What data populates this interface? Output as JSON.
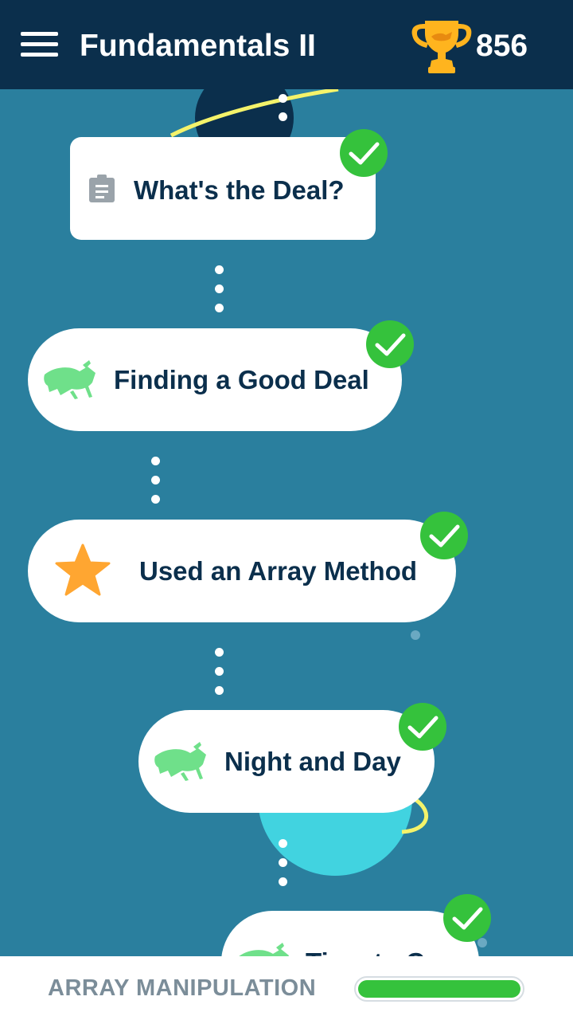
{
  "header": {
    "title": "Fundamentals II",
    "score": "856"
  },
  "lessons": [
    {
      "label": "What's the Deal?",
      "icon": "clipboard-icon",
      "completed": true
    },
    {
      "label": "Finding a Good Deal",
      "icon": "grasshopper-icon",
      "completed": true
    },
    {
      "label": "Used an Array Method",
      "icon": "star-icon",
      "completed": true
    },
    {
      "label": "Night and Day",
      "icon": "grasshopper-icon",
      "completed": true
    },
    {
      "label": "Time to C",
      "icon": "grasshopper-icon",
      "completed": true
    }
  ],
  "footer": {
    "topic": "ARRAY MANIPULATION",
    "progress": 1.0
  },
  "colors": {
    "header_bg": "#0b2f4c",
    "map_bg": "#2a7f9e",
    "check_green": "#35c23c",
    "grasshopper_green": "#6fe08a",
    "star_orange": "#ffa631"
  }
}
